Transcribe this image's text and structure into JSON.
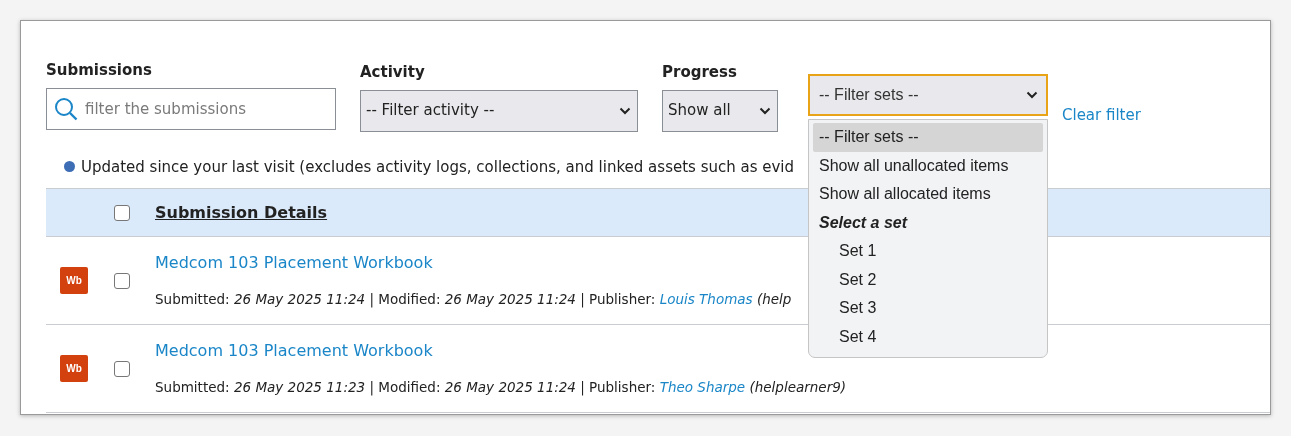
{
  "filters": {
    "submissions": {
      "label": "Submissions",
      "placeholder": "filter the submissions"
    },
    "activity": {
      "label": "Activity",
      "value": "-- Filter activity --"
    },
    "progress": {
      "label": "Progress",
      "value": "Show all"
    },
    "filter_sets": {
      "value": "-- Filter sets --",
      "expanded": true,
      "options": [
        {
          "kind": "option",
          "label": "-- Filter sets --",
          "selected": true
        },
        {
          "kind": "option",
          "label": "Show all unallocated items",
          "selected": false
        },
        {
          "kind": "option",
          "label": "Show all allocated items",
          "selected": false
        },
        {
          "kind": "group",
          "label": "Select a set",
          "children": [
            {
              "kind": "option",
              "label": "Set 1",
              "selected": false
            },
            {
              "kind": "option",
              "label": "Set 2",
              "selected": false
            },
            {
              "kind": "option",
              "label": "Set 3",
              "selected": false
            },
            {
              "kind": "option",
              "label": "Set 4",
              "selected": false
            }
          ]
        }
      ]
    },
    "clear_filter": "Clear filter"
  },
  "notice": "Updated since your last visit (excludes activity logs, collections, and linked assets such as evid",
  "table": {
    "header": {
      "checked": false,
      "title": "Submission Details"
    },
    "rows": [
      {
        "badge": "Wb",
        "checked": false,
        "title": "Medcom 103 Placement Workbook",
        "meta": "Submitted: *26 May 2025 11:24* | Modified: *26 May 2025 11:24* | Publisher: ",
        "publisher": "Louis Thomas",
        "publisher_suffix": " *(help*"
      },
      {
        "badge": "Wb",
        "checked": false,
        "title": "Medcom 103 Placement Workbook",
        "meta": "Submitted: *26 May 2025 11:23* | Modified: *26 May 2025 11:24* | Publisher: ",
        "publisher": "Theo Sharpe",
        "publisher_suffix": " *(helplearner9)*"
      }
    ]
  }
}
